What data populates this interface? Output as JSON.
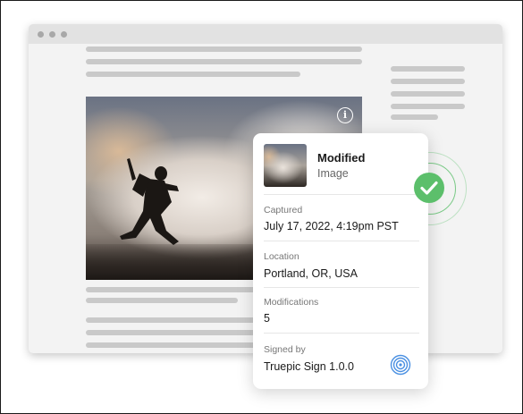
{
  "card": {
    "title": "Modified",
    "subtitle": "Image",
    "fields": [
      {
        "label": "Captured",
        "value": "July 17, 2022, 4:19pm PST"
      },
      {
        "label": "Location",
        "value": "Portland, OR, USA"
      },
      {
        "label": "Modifications",
        "value": "5"
      },
      {
        "label": "Signed by",
        "value": "Truepic Sign 1.0.0"
      }
    ]
  },
  "icons": {
    "info": "info-icon",
    "verified": "checkmark-icon",
    "signer": "fingerprint-icon"
  },
  "colors": {
    "verified_green": "#5cbf6b",
    "signer_blue": "#4a90e2"
  }
}
